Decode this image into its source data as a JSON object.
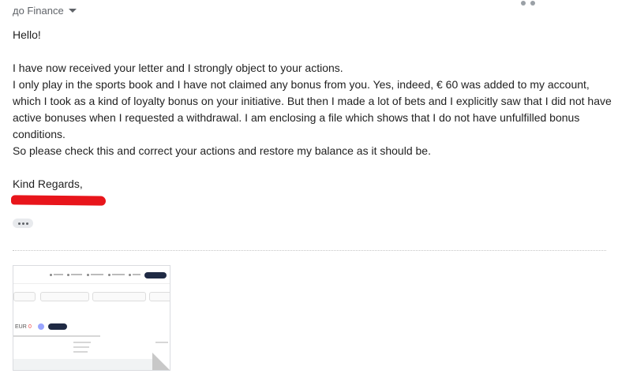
{
  "header": {
    "recipient_label": "до Finance"
  },
  "message": {
    "greeting": "Hello!",
    "paragraphs": [
      "I have now received your letter and I strongly object to your actions.",
      "I only play in the sports book and I have not claimed any bonus from you. Yes, indeed, € 60 was added to my account, which I took as a kind of loyalty bonus on your initiative. But then I made a lot of bets and I explicitly saw that I did not have active bonuses when I requested a withdrawal. I am enclosing a file which shows that I do not have unfulfilled bonus conditions.",
      "So please check this and correct your actions and restore my balance as it should be."
    ],
    "closing": "Kind Regards,"
  },
  "attachment": {
    "currency_label": "EUR",
    "balance_value": "0"
  },
  "colors": {
    "redaction": "#e8151b",
    "text": "#222222",
    "muted": "#5f6368"
  }
}
